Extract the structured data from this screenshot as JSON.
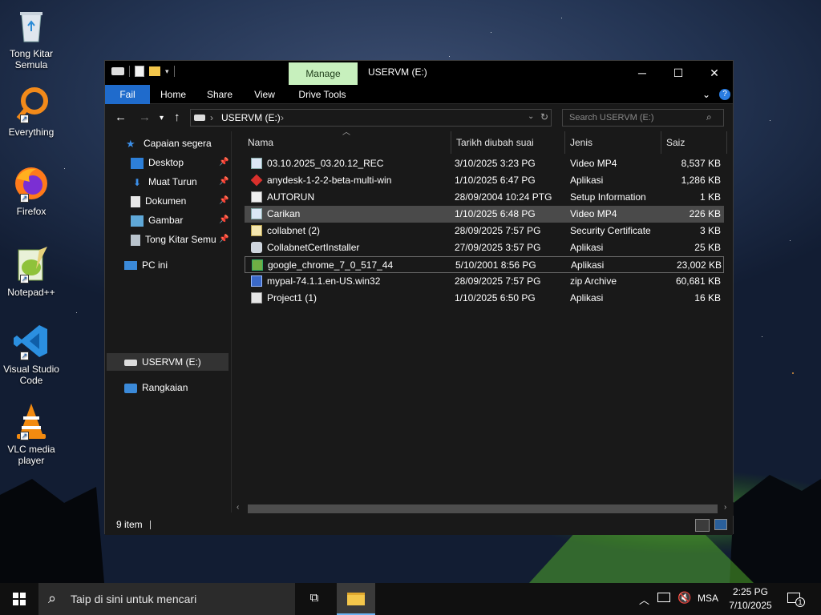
{
  "desktop": {
    "icons": [
      {
        "label_line1": "Tong Kitar",
        "label_line2": "Semula",
        "icon": "recycle-bin-icon"
      },
      {
        "label_line1": "Everything",
        "label_line2": "",
        "icon": "everything-search-icon"
      },
      {
        "label_line1": "Firefox",
        "label_line2": "",
        "icon": "firefox-icon"
      },
      {
        "label_line1": "Notepad++",
        "label_line2": "",
        "icon": "notepad-plus-plus-icon"
      },
      {
        "label_line1": "Visual Studio",
        "label_line2": "Code",
        "icon": "vscode-icon"
      },
      {
        "label_line1": "VLC media",
        "label_line2": "player",
        "icon": "vlc-icon"
      }
    ]
  },
  "window": {
    "title": "USERVM (E:)",
    "manage_tab": "Manage",
    "ribbon_tabs": [
      "Fail",
      "Home",
      "Share",
      "View",
      "Drive Tools"
    ],
    "address": "USERVM (E:)",
    "search_placeholder": "Search USERVM (E:)",
    "accent_color": "#1f6bcc"
  },
  "navpane": {
    "quick_access": "Capaian segera",
    "pinned": [
      "Desktop",
      "Muat Turun",
      "Dokumen",
      "Gambar",
      "Tong Kitar Semu"
    ],
    "this_pc": "PC ini",
    "drive": "USERVM (E:)",
    "network": "Rangkaian"
  },
  "columns": {
    "name": "Nama",
    "date": "Tarikh diubah suai",
    "type": "Jenis",
    "size": "Saiz"
  },
  "files": [
    {
      "name": "03.10.2025_03.20.12_REC",
      "date": "3/10/2025 3:23 PG",
      "type": "Video MP4",
      "size": "8,537 KB",
      "icon": "video-file-icon"
    },
    {
      "name": "anydesk-1-2-2-beta-multi-win",
      "date": "1/10/2025 6:47 PG",
      "type": "Aplikasi",
      "size": "1,286 KB",
      "icon": "anydesk-icon"
    },
    {
      "name": "AUTORUN",
      "date": "28/09/2004 10:24 PTG",
      "type": "Setup Information",
      "size": "1 KB",
      "icon": "setup-info-icon"
    },
    {
      "name": "Carikan",
      "date": "1/10/2025 6:48 PG",
      "type": "Video MP4",
      "size": "226 KB",
      "icon": "video-file-icon"
    },
    {
      "name": "collabnet (2)",
      "date": "28/09/2025 7:57 PG",
      "type": "Security Certificate",
      "size": "3 KB",
      "icon": "certificate-icon"
    },
    {
      "name": "CollabnetCertInstaller",
      "date": "27/09/2025 3:57 PG",
      "type": "Aplikasi",
      "size": "25 KB",
      "icon": "installer-icon"
    },
    {
      "name": "google_chrome_7_0_517_44",
      "date": "5/10/2001 8:56 PG",
      "type": "Aplikasi",
      "size": "23,002 KB",
      "icon": "chrome-installer-icon"
    },
    {
      "name": "mypal-74.1.1.en-US.win32",
      "date": "28/09/2025 7:57 PG",
      "type": "zip Archive",
      "size": "60,681 KB",
      "icon": "zip-archive-icon"
    },
    {
      "name": "Project1 (1)",
      "date": "1/10/2025 6:50 PG",
      "type": "Aplikasi",
      "size": "16 KB",
      "icon": "app-file-icon"
    }
  ],
  "status": {
    "count": "9 item"
  },
  "taskbar": {
    "search_placeholder": "Taip di sini untuk mencari",
    "language": "MSA",
    "time": "2:25 PG",
    "date": "7/10/2025",
    "notifications": "1"
  }
}
